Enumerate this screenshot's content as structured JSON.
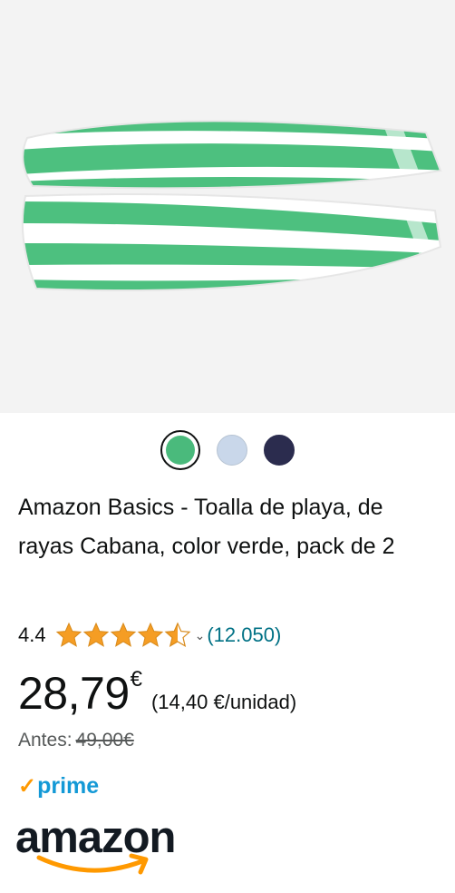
{
  "product": {
    "title": "Amazon Basics - Toalla de playa, de rayas Cabana, color verde, pack de 2",
    "image_icon": "striped-towel-image",
    "image_colors": {
      "stripe": "#4dc07f",
      "base": "#ffffff"
    }
  },
  "swatches": [
    {
      "name": "green",
      "color": "#4aba7c",
      "selected": true
    },
    {
      "name": "light-blue",
      "color": "#c9d7ea",
      "selected": false
    },
    {
      "name": "navy",
      "color": "#2b2c4e",
      "selected": false
    }
  ],
  "rating": {
    "value": "4.4",
    "stars": 4.5,
    "count": "(12.050)",
    "chevron_icon": "chevron-down-icon"
  },
  "price": {
    "amount": "28,79",
    "currency": "€",
    "unit_price": "(14,40 €/unidad)"
  },
  "previous_price": {
    "label": "Antes:",
    "value": "49,00€"
  },
  "prime": {
    "label": "prime",
    "check": "✓"
  },
  "logo": {
    "text": "amazon"
  },
  "colors": {
    "star": "#f59d24",
    "link": "#007185",
    "prime": "#1399d6",
    "accent": "#ff9900"
  }
}
